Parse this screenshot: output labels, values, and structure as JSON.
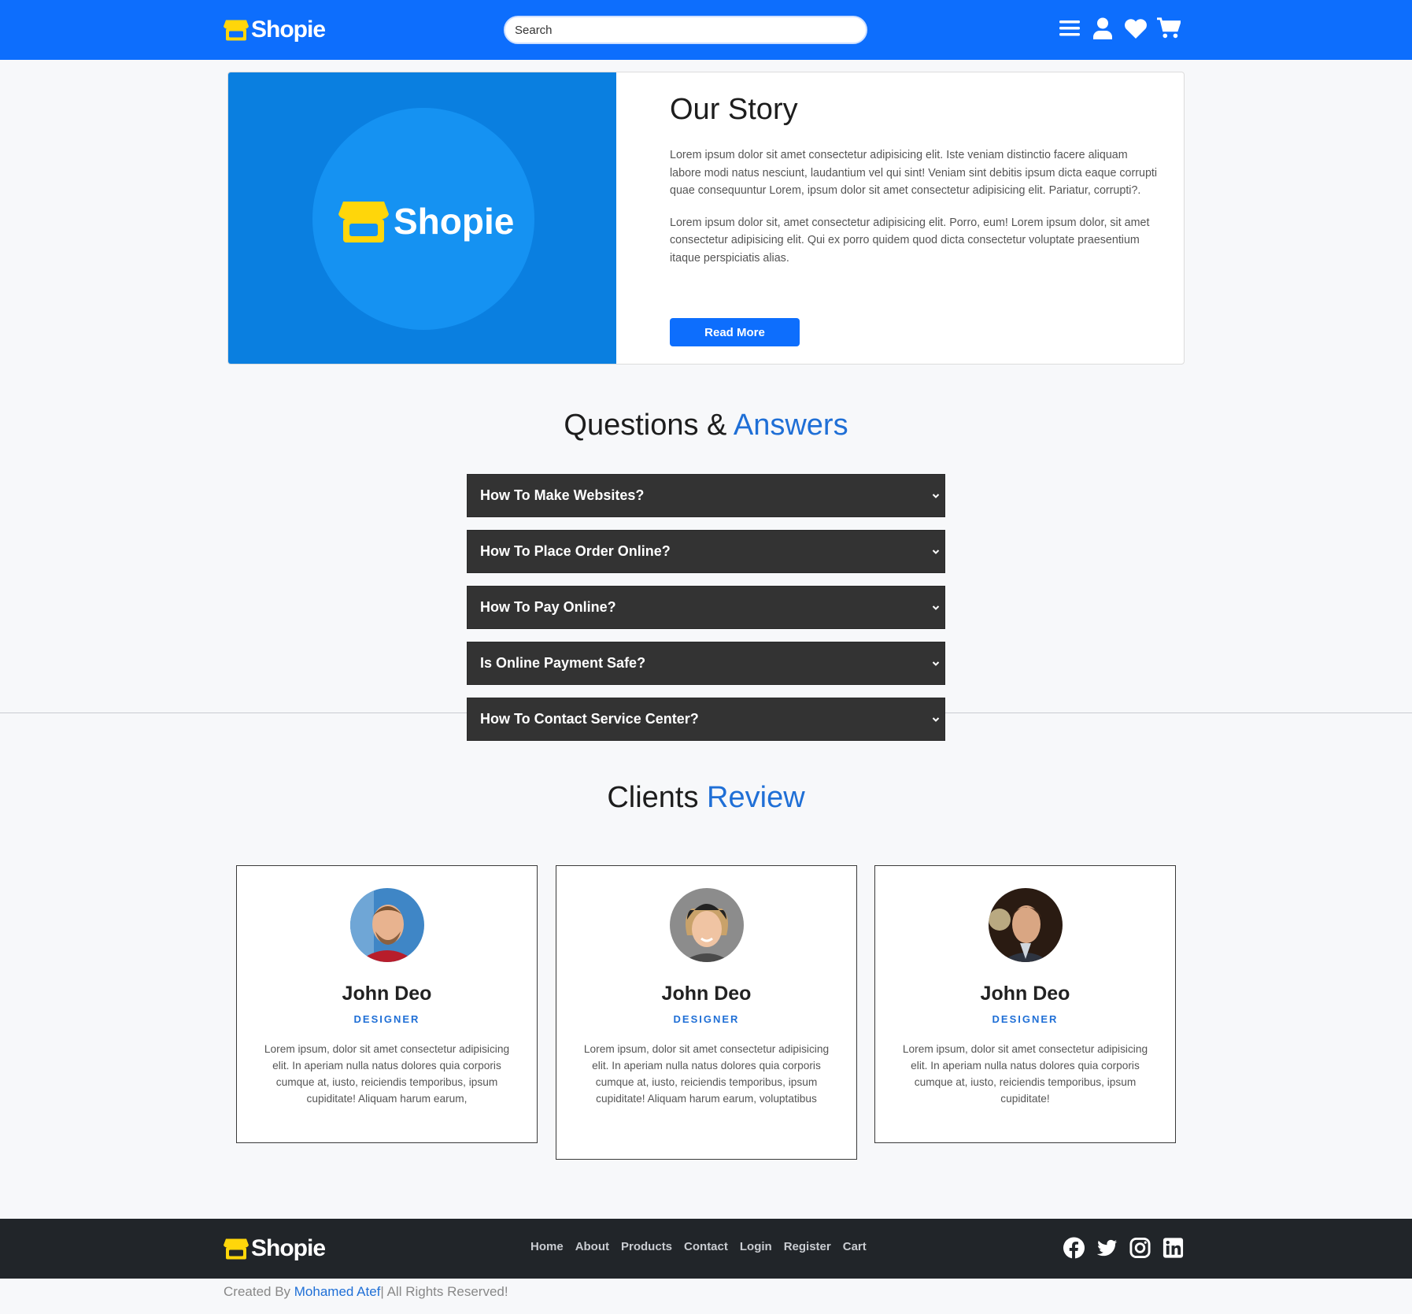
{
  "brand": {
    "name": "Shopie"
  },
  "navbar": {
    "search_placeholder": "Search",
    "icons": [
      "menu-icon",
      "user-icon",
      "heart-icon",
      "cart-icon"
    ]
  },
  "story": {
    "title": "Our Story",
    "paragraphs": [
      "Lorem ipsum dolor sit amet consectetur adipisicing elit. Iste veniam distinctio facere aliquam labore modi natus nesciunt, laudantium vel qui sint! Veniam sint debitis ipsum dicta eaque corrupti quae consequuntur Lorem, ipsum dolor sit amet consectetur adipisicing elit. Pariatur, corrupti?.",
      "Lorem ipsum dolor sit, amet consectetur adipisicing elit. Porro, eum! Lorem ipsum dolor, sit amet consectetur adipisicing elit. Qui ex porro quidem quod dicta consectetur voluptate praesentium itaque perspiciatis alias."
    ],
    "button": "Read More"
  },
  "faq": {
    "title_main": "Questions &",
    "title_accent": "Answers",
    "items": [
      "How To Make Websites?",
      "How To Place Order Online?",
      "How To Pay Online?",
      "Is Online Payment Safe?",
      "How To Contact Service Center?"
    ]
  },
  "reviews": {
    "title_main": "Clients",
    "title_accent": "Review",
    "cards": [
      {
        "name": "John Deo",
        "role": "DESIGNER",
        "text": "Lorem ipsum, dolor sit amet consectetur adipisicing elit. In aperiam nulla natus dolores quia corporis cumque at, iusto, reiciendis temporibus, ipsum cupiditate! Aliquam harum earum,"
      },
      {
        "name": "John Deo",
        "role": "DESIGNER",
        "text": "Lorem ipsum, dolor sit amet consectetur adipisicing elit. In aperiam nulla natus dolores quia corporis cumque at, iusto, reiciendis temporibus, ipsum cupiditate! Aliquam harum earum, voluptatibus"
      },
      {
        "name": "John Deo",
        "role": "DESIGNER",
        "text": "Lorem ipsum, dolor sit amet consectetur adipisicing elit. In aperiam nulla natus dolores quia corporis cumque at, iusto, reiciendis temporibus, ipsum cupiditate!"
      }
    ]
  },
  "footer": {
    "links": [
      "Home",
      "About",
      "Products",
      "Contact",
      "Login",
      "Register",
      "Cart"
    ],
    "socials": [
      "facebook-icon",
      "twitter-icon",
      "instagram-icon",
      "linkedin-icon"
    ],
    "copyright_prefix": "Created By ",
    "copyright_author": "Mohamed Atef",
    "copyright_suffix": "| All Rights Reserved!"
  },
  "colors": {
    "primary": "#0d6efd",
    "accent_text": "#1f6fd6",
    "faq_bg": "#333333",
    "footer_bg": "#212529",
    "logo_yellow": "#ffd60a"
  }
}
